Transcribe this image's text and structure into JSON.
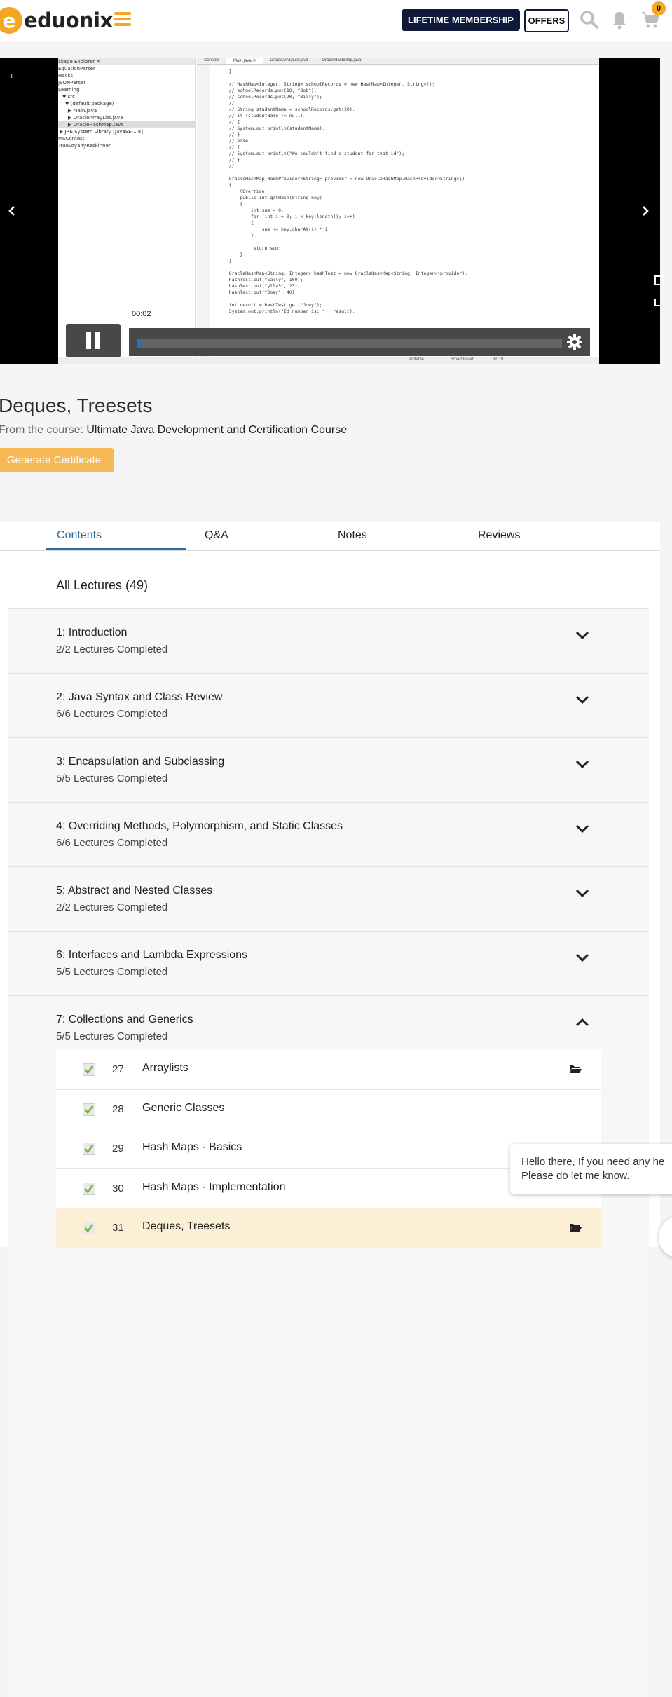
{
  "header": {
    "logo_mark": "e",
    "logo_text": "eduonix",
    "lifetime_label": "LIFETIME MEMBERSHIP",
    "offers_label": "OFFERS",
    "cart_count": "0",
    "icons": [
      "menu-icon",
      "search-icon",
      "bell-icon",
      "cart-icon"
    ]
  },
  "player": {
    "time": "00:02",
    "progress_fraction": 0.01,
    "ide": {
      "package_explorer": [
        "ckage Explorer ✕",
        "EquationParser",
        "Hacks",
        "JSONParser",
        "Learning",
        "▼ src",
        "▼ (default package)",
        "▶ Main.java",
        "▶ OracleArrayList.java",
        "▶ OracleHashMap.java",
        "▶ JRE System Library [JavaSE-1.8]",
        "MSContest",
        "TrueLoyaltyReskinner"
      ],
      "tabs": [
        "Console",
        "Main.java ✕",
        "OracleArrayList.java",
        "OracleHashMap.java"
      ],
      "code": "    }\n\n    // HashMap<Integer, String> schoolRecords = new HashMap<Integer, String>();\n    // schoolRecords.put(10, \"Bob\");\n    // schoolRecords.put(20, \"Billy\");\n    //\n    // String studentName = schoolRecords.get(20);\n    // if (studentName != null)\n    // {\n    // System.out.println(studentName);\n    // }\n    // else\n    // {\n    // System.out.println(\"We couldn't find a student for that id\");\n    // }\n    //\n\n    OracleHashMap.HashProvider<String> provider = new OracleHashMap.HashProvider<String>()\n    {\n        @Override\n        public int getHash(String key)\n        {\n            int sum = 0;\n            for (int i = 0; i < key.length(); i++)\n            {\n                sum += key.charAt(i) * i;\n            }\n\n            return sum;\n        }\n    };\n\n    OracleHashMap<String, Integer> hashTest = new OracleHashMap<String, Integer>(provider);\n    hashTest.put(\"Sally\", 100);\n    hashTest.put(\"ylla5\", 23);\n    hashTest.put(\"Joey\", 40);\n\n    int result = hashTest.get(\"Joey\");\n    System.out.println(\"Id number is: \" + result);",
      "status": [
        "Writable",
        "Smart Insert",
        "82 : 9"
      ]
    }
  },
  "lecture": {
    "title": "Deques, Treesets",
    "course_prefix": "From the course: ",
    "course_name": "Ultimate Java Development and Certification Course",
    "cert_button": "Generate Certificate"
  },
  "tabs": [
    "Contents",
    "Q&A",
    "Notes",
    "Reviews"
  ],
  "contents": {
    "heading": "All Lectures (49)",
    "sections": [
      {
        "title": "1: Introduction",
        "sub": "2/2 Lectures Completed",
        "expanded": false
      },
      {
        "title": "2: Java Syntax and Class Review",
        "sub": "6/6 Lectures Completed",
        "expanded": false
      },
      {
        "title": "3: Encapsulation and Subclassing",
        "sub": "5/5 Lectures Completed",
        "expanded": false
      },
      {
        "title": "4: Overriding Methods, Polymorphism, and Static Classes",
        "sub": "6/6 Lectures Completed",
        "expanded": false
      },
      {
        "title": "5: Abstract and Nested Classes",
        "sub": "2/2 Lectures Completed",
        "expanded": false
      },
      {
        "title": "6: Interfaces and Lambda Expressions",
        "sub": "5/5 Lectures Completed",
        "expanded": false
      },
      {
        "title": "7: Collections and Generics",
        "sub": "5/5 Lectures Completed",
        "expanded": true
      }
    ],
    "lectures": [
      {
        "num": "27",
        "title": "Arraylists",
        "folder": true,
        "current": false
      },
      {
        "num": "28",
        "title": "Generic Classes",
        "folder": false,
        "current": false
      },
      {
        "num": "29",
        "title": "Hash Maps - Basics",
        "folder": false,
        "current": false
      },
      {
        "num": "30",
        "title": "Hash Maps - Implementation",
        "folder": false,
        "current": false
      },
      {
        "num": "31",
        "title": "Deques, Treesets",
        "folder": true,
        "current": true
      }
    ]
  },
  "chat": {
    "line1": "Hello there, If you need any he",
    "line2": "Please do let me know."
  },
  "colors": {
    "brand": "#f5a623",
    "navy": "#0f1a3a",
    "tab_active": "#2a6c98",
    "check": "#7cb342",
    "current_row": "#fbf0d6"
  }
}
